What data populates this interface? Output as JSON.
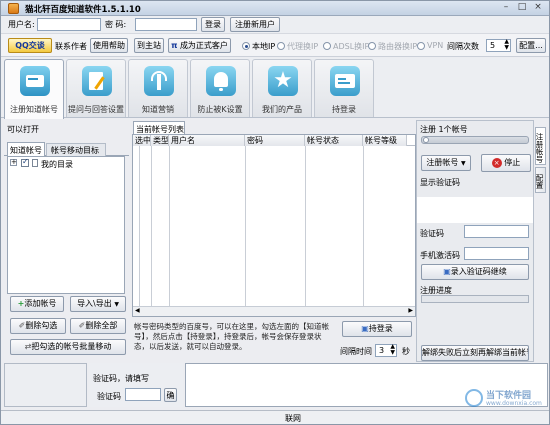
{
  "window": {
    "title": "猫北轩百度知道软件1.5.1.10"
  },
  "login": {
    "user_label": "用户名:",
    "pass_label": "密  码:",
    "login_btn": "登录",
    "register_btn": "注册新用户"
  },
  "toolbar": {
    "qq_btn": "QQ交谈",
    "contact_btn": "联系作者",
    "help_btn": "使用帮助",
    "home_btn": "到主站",
    "upgrade_btn": "成为正式客户",
    "ip_options": [
      "本地IP",
      "代理换IP",
      "ADSL换IP",
      "路由器换IP",
      "VPN"
    ],
    "retry_label": "间隔次数",
    "retry_value": "5",
    "config_btn": "配置..."
  },
  "tabs": [
    {
      "label": "注册知道帐号",
      "icon": "card-icon"
    },
    {
      "label": "提问与回答设置",
      "icon": "edit-icon"
    },
    {
      "label": "知道营销",
      "icon": "antenna-icon"
    },
    {
      "label": "防止被K设置",
      "icon": "bell-icon"
    },
    {
      "label": "我们的产品",
      "icon": "star-icon"
    },
    {
      "label": "持登录",
      "icon": "login-icon"
    }
  ],
  "left": {
    "title": "可以打开",
    "subtabs": [
      "知道帐号",
      "帐号移动目标"
    ],
    "tree_item": "我的目录",
    "buttons": [
      "添加帐号",
      "导入\\导出",
      "删除勾选",
      "删除全部",
      "把勾选的帐号批量移动"
    ]
  },
  "list": {
    "title": "当前帐号列表",
    "columns": [
      "选中",
      "类型",
      "用户名",
      "密码",
      "帐号状态",
      "帐号等级"
    ]
  },
  "hint": {
    "text": "帐号密码类型的百度号，可以在这里，勾选左面的【知道帐号】，然后点击【持登录】，持登录后，帐号会保存登录状态，以后发送，就可以自动登录。",
    "login_btn": "持登录",
    "interval_label": "间隔时间",
    "interval_value": "3",
    "interval_unit": "秒"
  },
  "right": {
    "title": "注册 1个帐号",
    "account_select": "注册帐号",
    "stop_btn": "停止",
    "captcha_show": "显示验证码",
    "captcha_label": "验证码",
    "activation_label": "手机激活码",
    "submit_btn": "录入验证码继续",
    "progress_label": "注册进度",
    "unlock_btn": "解绑失败后立刻再解绑当前帐号",
    "vertical_tabs": [
      "注册帐号",
      "配置"
    ]
  },
  "bottom": {
    "captcha_prompt": "验证码，请填写",
    "captcha_label": "验证码",
    "ok_btn": "确"
  },
  "status": {
    "text": "联网"
  },
  "watermark": {
    "brand": "当下软件园",
    "url": "www.downxia.com"
  },
  "colors": {
    "accent": "#2a4d8f",
    "stop_red": "#d22a2a",
    "tab_teal": "#46a3c9"
  }
}
